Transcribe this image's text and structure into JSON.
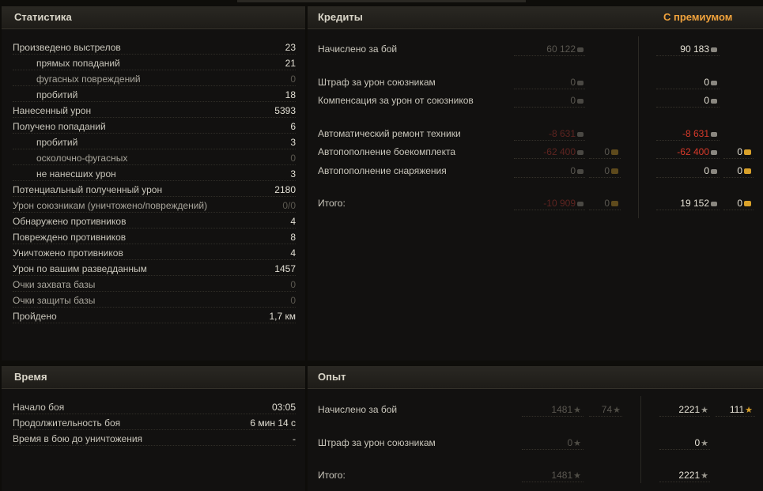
{
  "stats": {
    "title": "Статистика",
    "rows": [
      {
        "label": "Произведено выстрелов",
        "value": "23",
        "sub": false,
        "dim": false
      },
      {
        "label": "прямых попаданий",
        "value": "21",
        "sub": true,
        "dim": false
      },
      {
        "label": "фугасных повреждений",
        "value": "0",
        "sub": true,
        "dim": true
      },
      {
        "label": "пробитий",
        "value": "18",
        "sub": true,
        "dim": false
      },
      {
        "label": "Нанесенный урон",
        "value": "5393",
        "sub": false,
        "dim": false
      },
      {
        "label": "Получено попаданий",
        "value": "6",
        "sub": false,
        "dim": false
      },
      {
        "label": "пробитий",
        "value": "3",
        "sub": true,
        "dim": false
      },
      {
        "label": "осколочно-фугасных",
        "value": "0",
        "sub": true,
        "dim": true
      },
      {
        "label": "не нанесших урон",
        "value": "3",
        "sub": true,
        "dim": false
      },
      {
        "label": "Потенциальный полученный урон",
        "value": "2180",
        "sub": false,
        "dim": false
      },
      {
        "label": "Урон союзникам (уничтожено/повреждений)",
        "value": "0/0",
        "sub": false,
        "dim": true
      },
      {
        "label": "Обнаружено противников",
        "value": "4",
        "sub": false,
        "dim": false
      },
      {
        "label": "Повреждено противников",
        "value": "8",
        "sub": false,
        "dim": false
      },
      {
        "label": "Уничтожено противников",
        "value": "4",
        "sub": false,
        "dim": false
      },
      {
        "label": "Урон по вашим разведданным",
        "value": "1457",
        "sub": false,
        "dim": false
      },
      {
        "label": "Очки захвата базы",
        "value": "0",
        "sub": false,
        "dim": true
      },
      {
        "label": "Очки защиты базы",
        "value": "0",
        "sub": false,
        "dim": true
      },
      {
        "label": "Пройдено",
        "value": "1,7 км",
        "sub": false,
        "dim": false
      }
    ]
  },
  "credits": {
    "title": "Кредиты",
    "premium_title": "С премиумом",
    "rows": [
      {
        "label": "Начислено за бой",
        "base": "60 122",
        "base_gold": "",
        "prem": "90 183",
        "prem_gold": "",
        "red": false
      },
      {
        "label": "Штраф за урон союзникам",
        "base": "0",
        "base_gold": "",
        "prem": "0",
        "prem_gold": "",
        "red": false
      },
      {
        "label": "Компенсация за урон от союзников",
        "base": "0",
        "base_gold": "",
        "prem": "0",
        "prem_gold": "",
        "red": false
      },
      {
        "label": "Автоматический ремонт техники",
        "base": "-8 631",
        "base_gold": "",
        "prem": "-8 631",
        "prem_gold": "",
        "red": true
      },
      {
        "label": "Автопополнение боекомплекта",
        "base": "-62 400",
        "base_gold": "0",
        "prem": "-62 400",
        "prem_gold": "0",
        "red": true
      },
      {
        "label": "Автопополнение снаряжения",
        "base": "0",
        "base_gold": "0",
        "prem": "0",
        "prem_gold": "0",
        "red": false
      },
      {
        "label": "Итого:",
        "base": "-10 909",
        "base_gold": "0",
        "prem": "19 152",
        "prem_gold": "0",
        "red": false,
        "base_red": true
      }
    ]
  },
  "time": {
    "title": "Время",
    "rows": [
      {
        "label": "Начало боя",
        "value": "03:05"
      },
      {
        "label": "Продолжительность боя",
        "value": "6 мин 14 с"
      },
      {
        "label": "Время в бою до уничтожения",
        "value": "-"
      }
    ]
  },
  "xp": {
    "title": "Опыт",
    "rows": [
      {
        "label": "Начислено за бой",
        "base": "1481",
        "base_free": "74",
        "prem": "2221",
        "prem_free": "111"
      },
      {
        "label": "Штраф за урон союзникам",
        "base": "0",
        "base_free": "",
        "prem": "0",
        "prem_free": ""
      },
      {
        "label": "Итого:",
        "base": "1481",
        "base_free": "",
        "prem": "2221",
        "prem_free": ""
      }
    ]
  },
  "icons": {
    "silver_coin": "credit-icon",
    "gold_coin": "gold-icon",
    "experience": "star-icon"
  },
  "colors": {
    "accent": "#f0a23c",
    "negative": "#d83a2a",
    "gold": "#d9a12a"
  }
}
